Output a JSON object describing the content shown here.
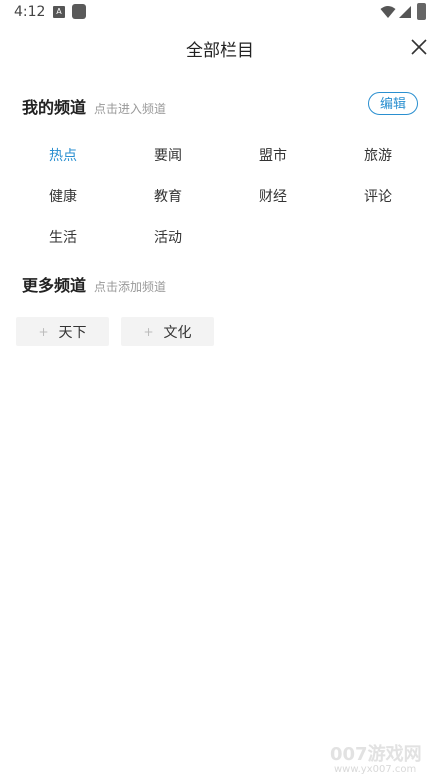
{
  "status_bar": {
    "time": "4:12",
    "a_badge": "A",
    "icons": [
      "a-icon",
      "square-icon",
      "wifi-icon",
      "signal-icon",
      "battery-icon"
    ]
  },
  "header": {
    "title": "全部栏目",
    "close_icon": "close-icon"
  },
  "my_channels": {
    "title": "我的频道",
    "hint": "点击进入频道",
    "edit_label": "编辑",
    "items": [
      {
        "label": "热点",
        "active": true
      },
      {
        "label": "要闻",
        "active": false
      },
      {
        "label": "盟市",
        "active": false
      },
      {
        "label": "旅游",
        "active": false
      },
      {
        "label": "健康",
        "active": false
      },
      {
        "label": "教育",
        "active": false
      },
      {
        "label": "财经",
        "active": false
      },
      {
        "label": "评论",
        "active": false
      },
      {
        "label": "生活",
        "active": false
      },
      {
        "label": "活动",
        "active": false
      }
    ]
  },
  "more_channels": {
    "title": "更多频道",
    "hint": "点击添加频道",
    "plus_glyph": "+",
    "items": [
      {
        "label": "天下"
      },
      {
        "label": "文化"
      }
    ]
  },
  "watermark": {
    "top": "007游戏网",
    "bottom": "www.yx007.com"
  },
  "colors": {
    "accent": "#2a8fd0",
    "text": "#222222",
    "hint": "#999999",
    "chip_bg": "#f3f3f3"
  }
}
